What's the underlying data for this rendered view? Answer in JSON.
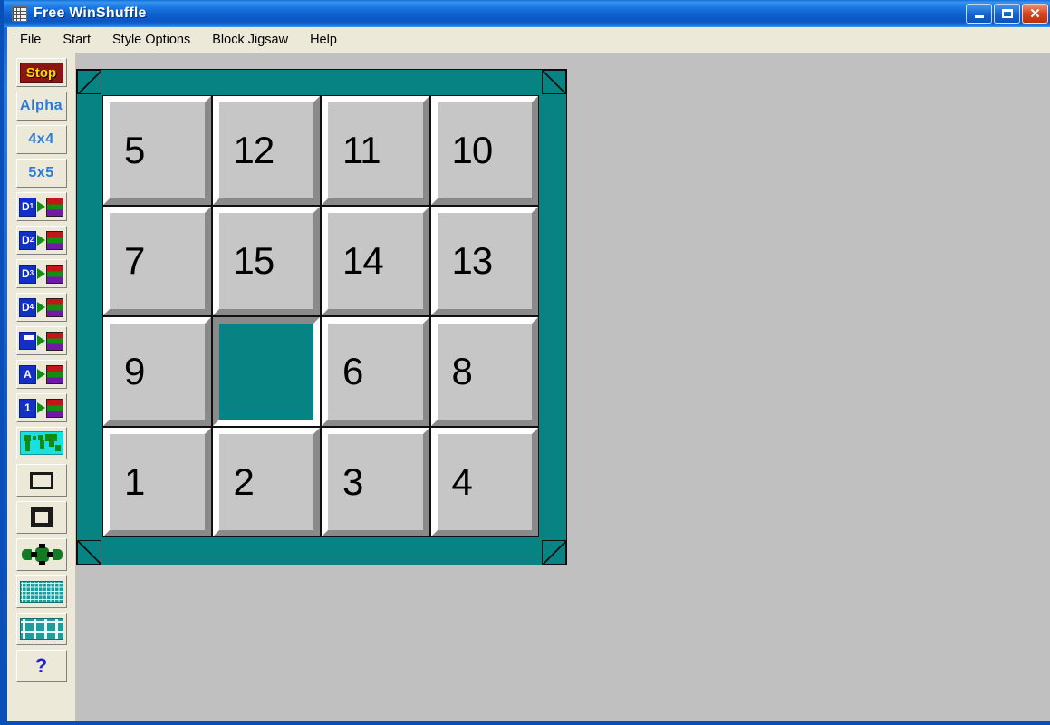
{
  "window": {
    "title": "Free WinShuffle",
    "app_icon": "grid-app-icon",
    "controls": [
      {
        "name": "minimize",
        "glyph": "_"
      },
      {
        "name": "maximize",
        "glyph": "□"
      },
      {
        "name": "close",
        "glyph": "✕"
      }
    ]
  },
  "menu": {
    "items": [
      "File",
      "Start",
      "Style Options",
      "Block Jigsaw",
      "Help"
    ]
  },
  "toolbar": {
    "buttons": [
      {
        "name": "stop-button",
        "label": "Stop",
        "kind": "label-stop"
      },
      {
        "name": "alpha-button",
        "label": "Alpha",
        "kind": "label-text"
      },
      {
        "name": "size-4x4-button",
        "label": "4x4",
        "kind": "label-text"
      },
      {
        "name": "size-5x5-button",
        "label": "5x5",
        "kind": "label-text"
      },
      {
        "name": "difficulty-1-button",
        "label": "D1",
        "kind": "d-icon",
        "digit": "1"
      },
      {
        "name": "difficulty-2-button",
        "label": "D2",
        "kind": "d-icon",
        "digit": "2"
      },
      {
        "name": "difficulty-3-button",
        "label": "D3",
        "kind": "d-icon",
        "digit": "3"
      },
      {
        "name": "difficulty-4-button",
        "label": "D4",
        "kind": "d-icon",
        "digit": "4"
      },
      {
        "name": "save-layout-button",
        "label": "Save",
        "kind": "disk-icon"
      },
      {
        "name": "alpha-tiles-button",
        "label": "A",
        "kind": "letter-icon",
        "letter": "A"
      },
      {
        "name": "number-tiles-button",
        "label": "1",
        "kind": "letter-icon",
        "letter": "1"
      },
      {
        "name": "world-map-button",
        "label": "World Map",
        "kind": "map-icon"
      },
      {
        "name": "outline-square-button",
        "label": "Outline",
        "kind": "square-outline"
      },
      {
        "name": "double-square-button",
        "label": "Double Outline",
        "kind": "square-double"
      },
      {
        "name": "jigsaw-button",
        "label": "Jigsaw",
        "kind": "jigsaw-icon"
      },
      {
        "name": "fine-grid-button",
        "label": "Fine Grid",
        "kind": "fine-grid"
      },
      {
        "name": "coarse-grid-button",
        "label": "Coarse Grid",
        "kind": "coarse-grid"
      },
      {
        "name": "help-button",
        "label": "?",
        "kind": "question"
      }
    ]
  },
  "board": {
    "size": "4x4",
    "blank_index": 9,
    "board_color": "#088383",
    "tile_face_color": "#c6c6c6",
    "tiles": [
      {
        "value": "5",
        "blank": false
      },
      {
        "value": "12",
        "blank": false
      },
      {
        "value": "11",
        "blank": false
      },
      {
        "value": "10",
        "blank": false
      },
      {
        "value": "7",
        "blank": false
      },
      {
        "value": "15",
        "blank": false
      },
      {
        "value": "14",
        "blank": false
      },
      {
        "value": "13",
        "blank": false
      },
      {
        "value": "9",
        "blank": false
      },
      {
        "value": "",
        "blank": true
      },
      {
        "value": "6",
        "blank": false
      },
      {
        "value": "8",
        "blank": false
      },
      {
        "value": "1",
        "blank": false
      },
      {
        "value": "2",
        "blank": false
      },
      {
        "value": "3",
        "blank": false
      },
      {
        "value": "4",
        "blank": false
      }
    ]
  }
}
